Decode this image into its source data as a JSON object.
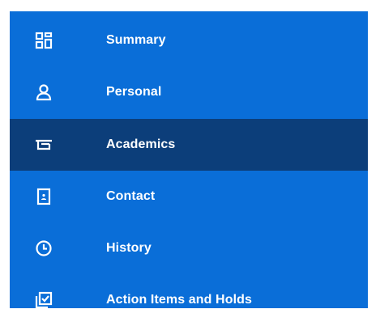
{
  "sidebar": {
    "active_index": 2,
    "background": "#0a6ed8",
    "active_background": "#0c3e7a",
    "items": [
      {
        "label": "Summary",
        "icon": "dashboard-grid-icon"
      },
      {
        "label": "Personal",
        "icon": "person-icon"
      },
      {
        "label": "Academics",
        "icon": "mortarboard-icon"
      },
      {
        "label": "Contact",
        "icon": "contact-book-icon"
      },
      {
        "label": "History",
        "icon": "clock-icon"
      },
      {
        "label": "Action Items and Holds",
        "icon": "checklist-icon"
      }
    ]
  }
}
